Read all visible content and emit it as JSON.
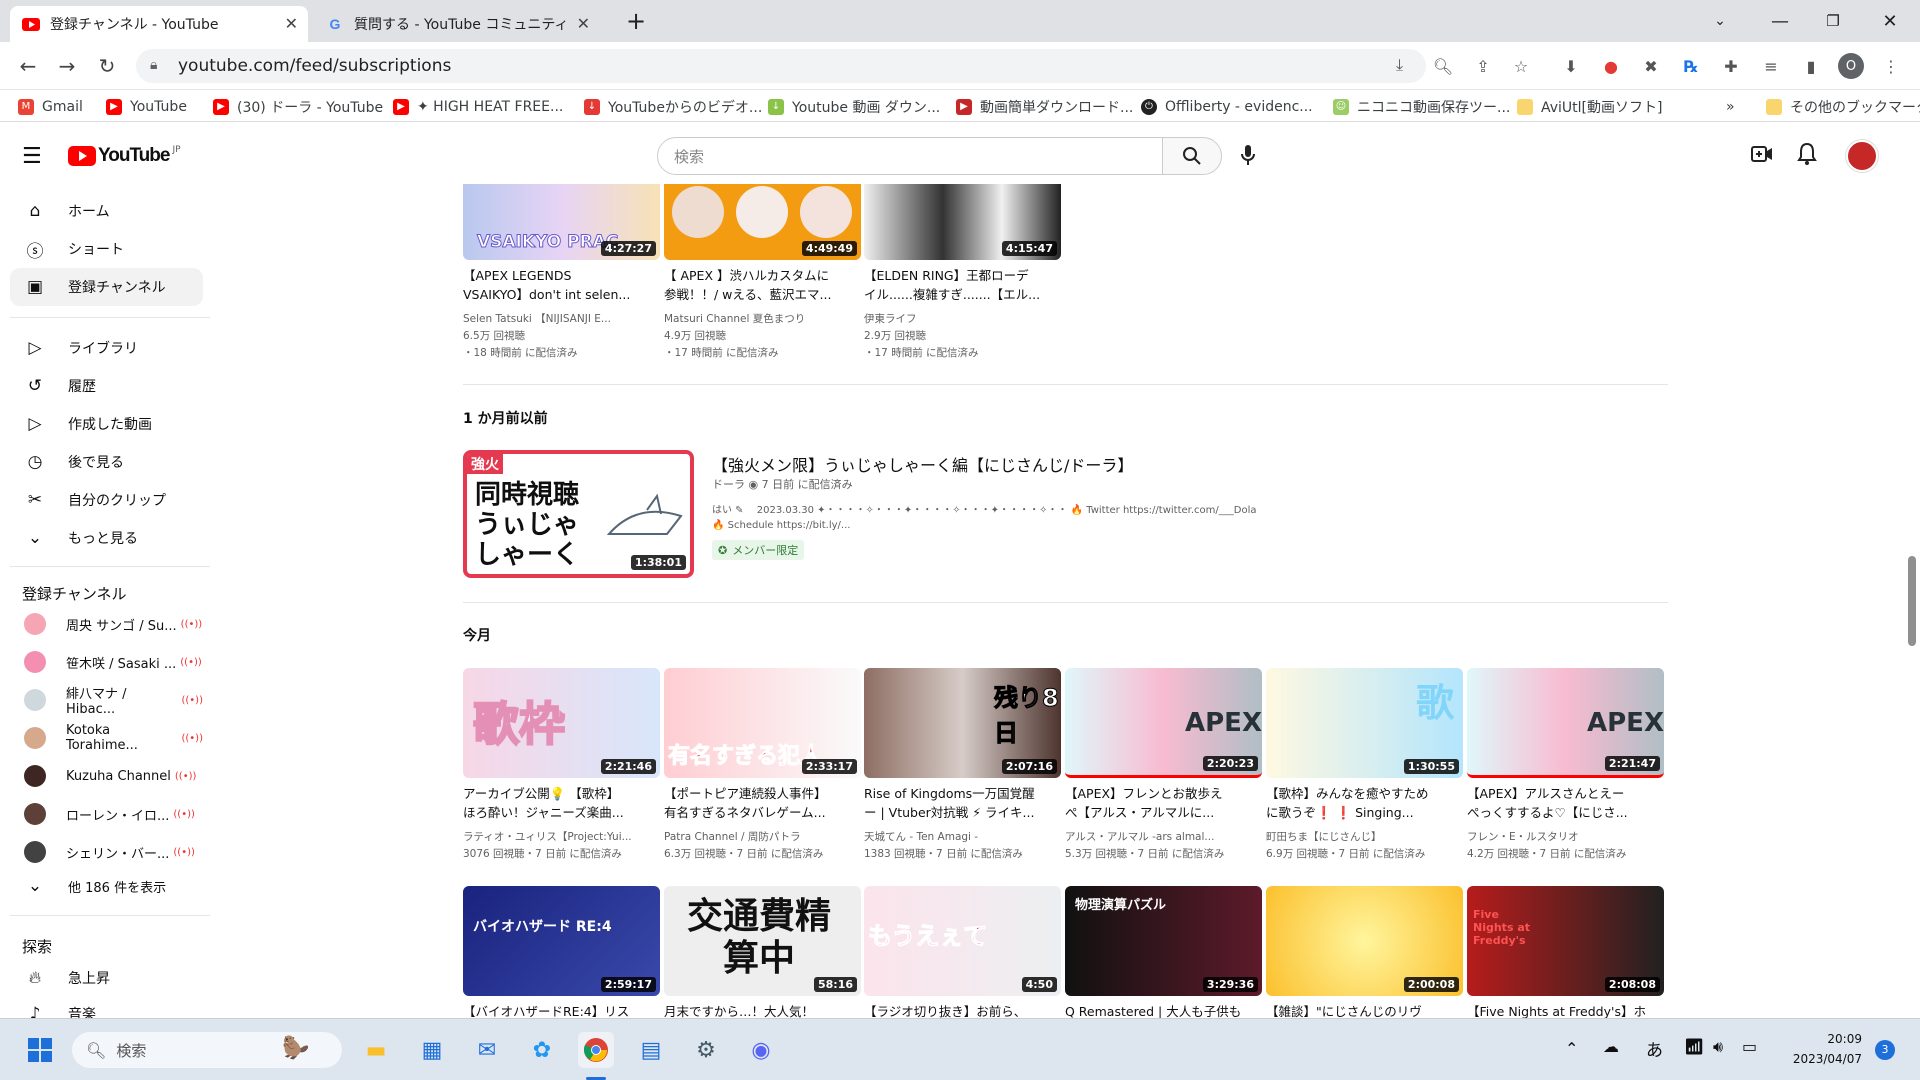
{
  "browser": {
    "tabs": [
      {
        "title": "登録チャンネル - YouTube",
        "active": true
      },
      {
        "title": "質問する - YouTube コミュニティ",
        "active": false
      }
    ],
    "new_tab": "+",
    "url": "youtube.com/feed/subscriptions",
    "bookmarks": [
      "Gmail",
      "YouTube",
      "(30) ドーラ - YouTube",
      "✦ HIGH HEAT FREE...",
      "YouTubeからのビデオ...",
      "Youtube 動画 ダウン...",
      "動画簡単ダウンロード...",
      "Offliberty - evidenc...",
      "ニコニコ動画保存ツー...",
      "AviUtl[動画ソフト]"
    ],
    "bookmarks_more": "»",
    "other_bookmarks": "その他のブックマーク",
    "profile_initial": "O"
  },
  "youtube": {
    "logo_text": "YouTube",
    "logo_region": "JP",
    "search_placeholder": "検索",
    "sidebar": {
      "primary": [
        "ホーム",
        "ショート",
        "登録チャンネル"
      ],
      "library": [
        "ライブラリ",
        "履歴",
        "作成した動画",
        "後で見る",
        "自分のクリップ",
        "もっと見る"
      ],
      "subs_heading": "登録チャンネル",
      "channels": [
        {
          "name": "周央 サンゴ / Su...",
          "live": "((•))"
        },
        {
          "name": "笹木咲 / Sasaki ...",
          "live": "((•))"
        },
        {
          "name": "緋八マナ / Hibac...",
          "live": "((•))"
        },
        {
          "name": "Kotoka Torahime...",
          "live": "((•))"
        },
        {
          "name": "Kuzuha Channel",
          "live": "((•))"
        },
        {
          "name": "ローレン・イロ...",
          "live": "((•))"
        },
        {
          "name": "シェリン・バー...",
          "live": "((•))"
        }
      ],
      "show_more": "他 186 件を表示",
      "explore_heading": "探索",
      "explore": [
        "急上昇",
        "音楽"
      ]
    },
    "top_row": [
      {
        "thumb_text": "VSAIKYO PRAC",
        "duration": "4:27:27",
        "title1": "【APEX LEGENDS",
        "title2": "VSAIKYO】don't int selen...",
        "channel": "Selen Tatsuki 【NIJISANJI E...",
        "views": "6.5万 回視聴",
        "time": "・18 時間前 に配信済み"
      },
      {
        "thumb_text": "",
        "duration": "4:49:49",
        "title1": "【 APEX 】渋ハルカスタムに",
        "title2": "参戦！！/ wえる、藍沢エマ...",
        "channel": "Matsuri Channel 夏色まつり",
        "views": "4.9万 回視聴",
        "time": "・17 時間前 に配信済み"
      },
      {
        "thumb_text": "",
        "duration": "4:15:47",
        "title1": "【ELDEN RING】王都ローデ",
        "title2": "イル......複雑すぎ.......【エル...",
        "channel": "伊東ライフ",
        "views": "2.9万 回視聴",
        "time": "・17 時間前 に配信済み"
      }
    ],
    "section_month": "1 か月前以前",
    "member_video": {
      "badge": "強火",
      "thumb_line1": "同時視聴",
      "thumb_line2": "うぃじゃ",
      "thumb_line3": "しゃーく",
      "duration": "1:38:01",
      "title": "【強火メン限】うぃじゃしゃーく編【にじさんじ/ドーラ】",
      "channel": "ドーラ",
      "time": "7 日前 に配信済み",
      "desc1": "はい ✎ 　2023.03.30 ✦・・・・✧・・・✦・・・・✧・・・✦・・・・✧・・ 🔥 Twitter https://twitter.com/___Dola",
      "desc2": "🔥 Schedule https://bit.ly/...",
      "member_badge": "メンバー限定"
    },
    "section_today": "今月",
    "grid_row1": [
      {
        "thumb_text": "歌枠",
        "duration": "2:21:46",
        "title1": "アーカイブ公開💡 【歌枠】",
        "title2": "ほろ酔い！ジャニーズ楽曲...",
        "meta": "ラティオ・ユィリス【Project:Yui...",
        "meta2": "3076 回視聴・7 日前 に配信済み"
      },
      {
        "thumb_text": "有名すぎる犯人",
        "duration": "2:33:17",
        "title1": "【ポートピア連続殺人事件】",
        "title2": "有名すぎるネタバレゲーム...",
        "meta": "Patra Channel / 周防パトラ",
        "meta2": "6.3万 回視聴・7 日前 に配信済み"
      },
      {
        "thumb_text": "残り8日",
        "duration": "2:07:16",
        "title1": "Rise of Kingdoms一万国覚醒",
        "title2": "ー | Vtuber対抗戦 ⚡ ライキ...",
        "meta": "天城てん - Ten Amagi -",
        "meta2": "1383 回視聴・7 日前 に配信済み"
      },
      {
        "thumb_text": "APEX",
        "duration": "2:20:23",
        "title1": "【APEX】フレンとお散歩え",
        "title2": "ぺ【アルス・アルマルに...",
        "meta": "アルス・アルマル -ars almal...",
        "meta2": "5.3万 回視聴・7 日前 に配信済み"
      },
      {
        "thumb_text": "歌",
        "duration": "1:30:55",
        "title1": "【歌枠】みんなを癒やすため",
        "title2": "に歌うぞ❗ ❗ Singing...",
        "meta": "町田ちま【にじさんじ】",
        "meta2": "6.9万 回視聴・7 日前 に配信済み"
      },
      {
        "thumb_text": "APEX",
        "duration": "2:21:47",
        "title1": "【APEX】アルスさんとえー",
        "title2": "ぺっくすするよ♡【にじさ...",
        "meta": "フレン・E・ルスタリオ",
        "meta2": "4.2万 回視聴・7 日前 に配信済み"
      }
    ],
    "grid_row2": [
      {
        "thumb_text": "バイオハザード RE:4",
        "duration": "2:59:17",
        "title1": "【バイオハザードRE:4】リス"
      },
      {
        "thumb_text": "交通費精算中",
        "duration": "58:16",
        "title1": "月末ですから…！大人気！"
      },
      {
        "thumb_text": "もうえぇて",
        "duration": "4:50",
        "title1": "【ラジオ切り抜き】お前ら、"
      },
      {
        "thumb_text": "物理演算パズル",
        "duration": "3:29:36",
        "title1": "Q Remastered | 大人も子供も"
      },
      {
        "thumb_text": "",
        "duration": "2:00:08",
        "title1": "【雑談】\"にじさんじのリヴ"
      },
      {
        "thumb_text": "Five Nights at Freddy's",
        "duration": "2:08:08",
        "title1": "【Five Nights at Freddy's】ホ"
      }
    ]
  },
  "taskbar": {
    "search_placeholder": "検索",
    "ime": "あ",
    "time": "20:09",
    "date": "2023/04/07",
    "notifications": "3"
  },
  "colors": {
    "yt_red": "#ff0000",
    "accent_blue": "#065fd4"
  }
}
